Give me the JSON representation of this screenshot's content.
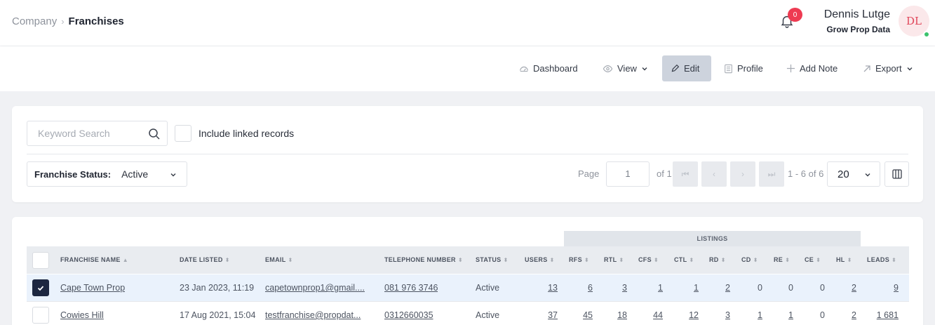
{
  "breadcrumb": {
    "parent": "Company",
    "current": "Franchises"
  },
  "header": {
    "notification_count": "0",
    "user_name": "Dennis Lutge",
    "user_company": "Grow Prop Data",
    "avatar_initials": "DL"
  },
  "toolbar": {
    "dashboard": "Dashboard",
    "view": "View",
    "edit": "Edit",
    "profile": "Profile",
    "add_note": "Add Note",
    "export": "Export"
  },
  "filters": {
    "search_placeholder": "Keyword Search",
    "include_linked": "Include linked records",
    "status_label": "Franchise Status:",
    "status_value": "Active"
  },
  "pagination": {
    "page_label": "Page",
    "page_value": "1",
    "of_label": "of 1",
    "range": "1 - 6 of 6",
    "per_page": "20"
  },
  "table": {
    "group_header": "LISTINGS",
    "columns": {
      "name": "FRANCHISE NAME",
      "date": "DATE LISTED",
      "email": "EMAIL",
      "phone": "TELEPHONE NUMBER",
      "status": "STATUS",
      "users": "USERS",
      "rfs": "RFS",
      "rtl": "RTL",
      "cfs": "CFS",
      "ctl": "CTL",
      "rd": "RD",
      "cd": "CD",
      "re": "RE",
      "ce": "CE",
      "hl": "HL",
      "leads": "LEADS"
    },
    "rows": [
      {
        "name": "Cape Town Prop",
        "date": "23 Jan 2023, 11:19",
        "email": "capetownprop1@gmail....",
        "phone": "081 976 3746",
        "status": "Active",
        "users": "13",
        "rfs": "6",
        "rtl": "3",
        "cfs": "1",
        "ctl": "1",
        "rd": "2",
        "cd": "0",
        "re": "0",
        "ce": "0",
        "hl": "2",
        "leads": "9"
      },
      {
        "name": "Cowies Hill",
        "date": "17 Aug 2021, 15:04",
        "email": "testfranchise@propdat...",
        "phone": "0312660035",
        "status": "Active",
        "users": "37",
        "rfs": "45",
        "rtl": "18",
        "cfs": "44",
        "ctl": "12",
        "rd": "3",
        "cd": "1",
        "re": "1",
        "ce": "0",
        "hl": "2",
        "leads": "1 681"
      }
    ]
  },
  "colors": {
    "accent": "#1d2740",
    "badge": "#ee3b52",
    "online": "#3cc36d",
    "selected_row": "#eaf2fc"
  }
}
